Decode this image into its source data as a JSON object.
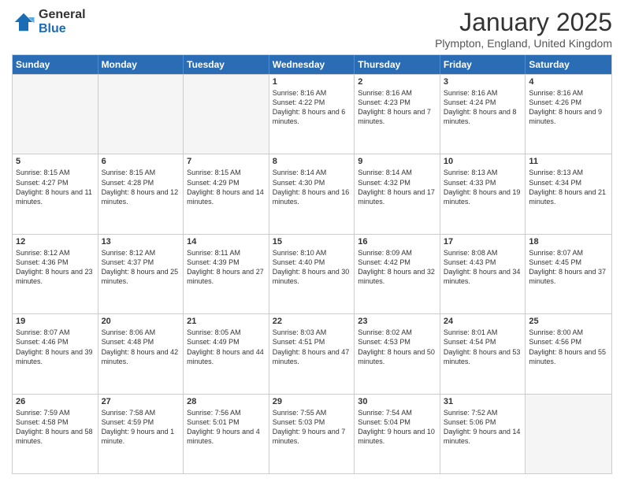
{
  "header": {
    "logo_general": "General",
    "logo_blue": "Blue",
    "month_title": "January 2025",
    "location": "Plympton, England, United Kingdom"
  },
  "weekdays": [
    "Sunday",
    "Monday",
    "Tuesday",
    "Wednesday",
    "Thursday",
    "Friday",
    "Saturday"
  ],
  "rows": [
    [
      {
        "day": "",
        "info": ""
      },
      {
        "day": "",
        "info": ""
      },
      {
        "day": "",
        "info": ""
      },
      {
        "day": "1",
        "info": "Sunrise: 8:16 AM\nSunset: 4:22 PM\nDaylight: 8 hours and 6 minutes."
      },
      {
        "day": "2",
        "info": "Sunrise: 8:16 AM\nSunset: 4:23 PM\nDaylight: 8 hours and 7 minutes."
      },
      {
        "day": "3",
        "info": "Sunrise: 8:16 AM\nSunset: 4:24 PM\nDaylight: 8 hours and 8 minutes."
      },
      {
        "day": "4",
        "info": "Sunrise: 8:16 AM\nSunset: 4:26 PM\nDaylight: 8 hours and 9 minutes."
      }
    ],
    [
      {
        "day": "5",
        "info": "Sunrise: 8:15 AM\nSunset: 4:27 PM\nDaylight: 8 hours and 11 minutes."
      },
      {
        "day": "6",
        "info": "Sunrise: 8:15 AM\nSunset: 4:28 PM\nDaylight: 8 hours and 12 minutes."
      },
      {
        "day": "7",
        "info": "Sunrise: 8:15 AM\nSunset: 4:29 PM\nDaylight: 8 hours and 14 minutes."
      },
      {
        "day": "8",
        "info": "Sunrise: 8:14 AM\nSunset: 4:30 PM\nDaylight: 8 hours and 16 minutes."
      },
      {
        "day": "9",
        "info": "Sunrise: 8:14 AM\nSunset: 4:32 PM\nDaylight: 8 hours and 17 minutes."
      },
      {
        "day": "10",
        "info": "Sunrise: 8:13 AM\nSunset: 4:33 PM\nDaylight: 8 hours and 19 minutes."
      },
      {
        "day": "11",
        "info": "Sunrise: 8:13 AM\nSunset: 4:34 PM\nDaylight: 8 hours and 21 minutes."
      }
    ],
    [
      {
        "day": "12",
        "info": "Sunrise: 8:12 AM\nSunset: 4:36 PM\nDaylight: 8 hours and 23 minutes."
      },
      {
        "day": "13",
        "info": "Sunrise: 8:12 AM\nSunset: 4:37 PM\nDaylight: 8 hours and 25 minutes."
      },
      {
        "day": "14",
        "info": "Sunrise: 8:11 AM\nSunset: 4:39 PM\nDaylight: 8 hours and 27 minutes."
      },
      {
        "day": "15",
        "info": "Sunrise: 8:10 AM\nSunset: 4:40 PM\nDaylight: 8 hours and 30 minutes."
      },
      {
        "day": "16",
        "info": "Sunrise: 8:09 AM\nSunset: 4:42 PM\nDaylight: 8 hours and 32 minutes."
      },
      {
        "day": "17",
        "info": "Sunrise: 8:08 AM\nSunset: 4:43 PM\nDaylight: 8 hours and 34 minutes."
      },
      {
        "day": "18",
        "info": "Sunrise: 8:07 AM\nSunset: 4:45 PM\nDaylight: 8 hours and 37 minutes."
      }
    ],
    [
      {
        "day": "19",
        "info": "Sunrise: 8:07 AM\nSunset: 4:46 PM\nDaylight: 8 hours and 39 minutes."
      },
      {
        "day": "20",
        "info": "Sunrise: 8:06 AM\nSunset: 4:48 PM\nDaylight: 8 hours and 42 minutes."
      },
      {
        "day": "21",
        "info": "Sunrise: 8:05 AM\nSunset: 4:49 PM\nDaylight: 8 hours and 44 minutes."
      },
      {
        "day": "22",
        "info": "Sunrise: 8:03 AM\nSunset: 4:51 PM\nDaylight: 8 hours and 47 minutes."
      },
      {
        "day": "23",
        "info": "Sunrise: 8:02 AM\nSunset: 4:53 PM\nDaylight: 8 hours and 50 minutes."
      },
      {
        "day": "24",
        "info": "Sunrise: 8:01 AM\nSunset: 4:54 PM\nDaylight: 8 hours and 53 minutes."
      },
      {
        "day": "25",
        "info": "Sunrise: 8:00 AM\nSunset: 4:56 PM\nDaylight: 8 hours and 55 minutes."
      }
    ],
    [
      {
        "day": "26",
        "info": "Sunrise: 7:59 AM\nSunset: 4:58 PM\nDaylight: 8 hours and 58 minutes."
      },
      {
        "day": "27",
        "info": "Sunrise: 7:58 AM\nSunset: 4:59 PM\nDaylight: 9 hours and 1 minute."
      },
      {
        "day": "28",
        "info": "Sunrise: 7:56 AM\nSunset: 5:01 PM\nDaylight: 9 hours and 4 minutes."
      },
      {
        "day": "29",
        "info": "Sunrise: 7:55 AM\nSunset: 5:03 PM\nDaylight: 9 hours and 7 minutes."
      },
      {
        "day": "30",
        "info": "Sunrise: 7:54 AM\nSunset: 5:04 PM\nDaylight: 9 hours and 10 minutes."
      },
      {
        "day": "31",
        "info": "Sunrise: 7:52 AM\nSunset: 5:06 PM\nDaylight: 9 hours and 14 minutes."
      },
      {
        "day": "",
        "info": ""
      }
    ]
  ]
}
